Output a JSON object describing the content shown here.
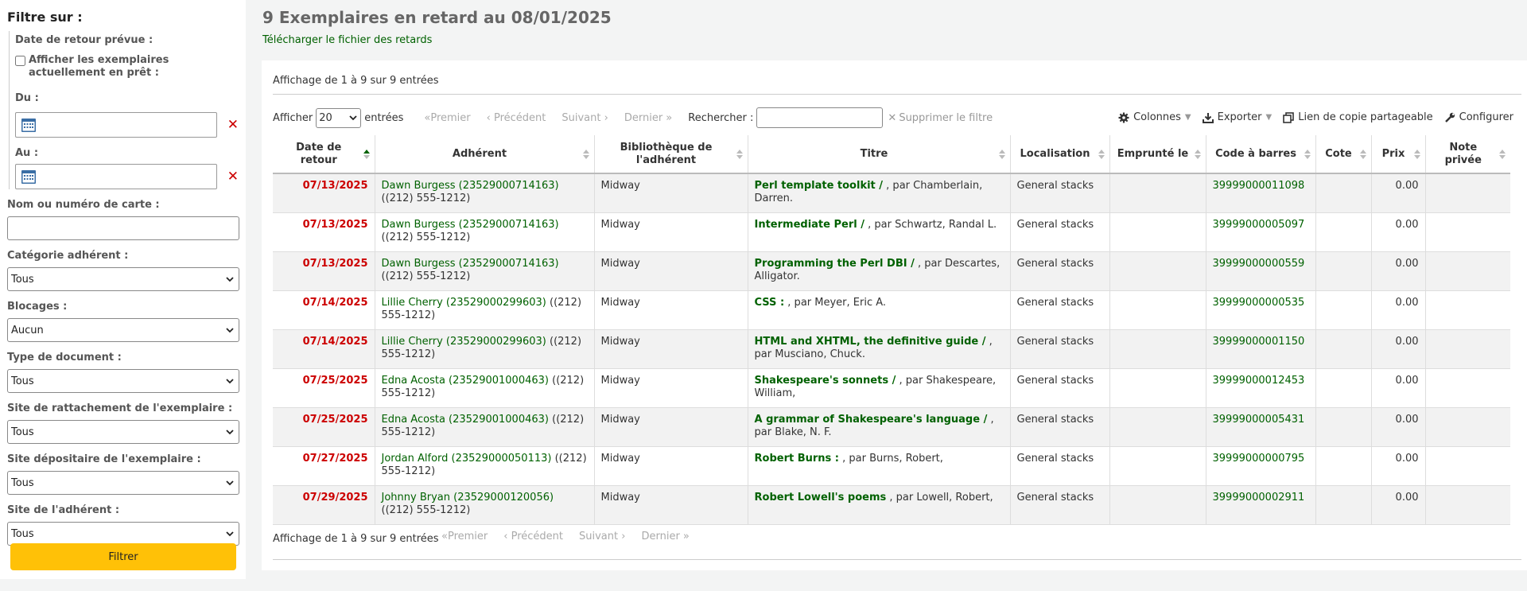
{
  "sidebar": {
    "heading": "Filtre sur :",
    "due_date_label": "Date de retour prévue :",
    "show_checked_out_label": "Afficher les exemplaires actuellement en prêt :",
    "from_label": "Du :",
    "to_label": "Au :",
    "patron_label": "Nom ou numéro de carte :",
    "patron_value": "",
    "category_label": "Catégorie adhérent :",
    "category_value": "Tous",
    "restrictions_label": "Blocages :",
    "restrictions_value": "Aucun",
    "itemtype_label": "Type de document :",
    "itemtype_value": "Tous",
    "homebranch_label": "Site de rattachement de l'exemplaire :",
    "homebranch_value": "Tous",
    "holdingbranch_label": "Site dépositaire de l'exemplaire :",
    "holdingbranch_value": "Tous",
    "patronbranch_label": "Site de l'adhérent :",
    "patronbranch_value": "Tous",
    "filter_button": "Filtrer"
  },
  "main": {
    "title": "9 Exemplaires en retard au 08/01/2025",
    "download_link": "Télécharger le fichier des retards",
    "info_top": "Affichage de 1 à 9 sur 9 entrées",
    "info_bottom": "Affichage de 1 à 9 sur 9 entrées",
    "show_label": "Afficher",
    "page_size": "20",
    "entries_label": "entrées",
    "pager": {
      "first": "Premier",
      "prev": "Précédent",
      "next": "Suivant",
      "last": "Dernier"
    },
    "search_label": "Rechercher :",
    "search_value": "",
    "clear_filter": "Supprimer le filtre",
    "columns_btn": "Colonnes",
    "export_btn": "Exporter",
    "share_btn": "Lien de copie partageable",
    "configure_btn": "Configurer"
  },
  "table": {
    "headers": [
      "Date de retour",
      "Adhérent",
      "Bibliothèque de l'adhérent",
      "Titre",
      "Localisation",
      "Emprunté le",
      "Code à barres",
      "Cote",
      "Prix",
      "Note privée"
    ],
    "rows": [
      {
        "due": "07/13/2025",
        "patron": "Dawn Burgess (23529000714163)",
        "phone": "((212) 555-1212)",
        "library": "Midway",
        "title": "Perl template toolkit /",
        "author": ", par Chamberlain, Darren.",
        "location": "General stacks",
        "checkout": "",
        "barcode": "39999000011098",
        "callnumber": "",
        "price": "0.00",
        "note": ""
      },
      {
        "due": "07/13/2025",
        "patron": "Dawn Burgess (23529000714163)",
        "phone": "((212) 555-1212)",
        "library": "Midway",
        "title": "Intermediate Perl /",
        "author": ", par Schwartz, Randal L.",
        "location": "General stacks",
        "checkout": "",
        "barcode": "39999000005097",
        "callnumber": "",
        "price": "0.00",
        "note": ""
      },
      {
        "due": "07/13/2025",
        "patron": "Dawn Burgess (23529000714163)",
        "phone": "((212) 555-1212)",
        "library": "Midway",
        "title": "Programming the Perl DBI /",
        "author": ", par Descartes, Alligator.",
        "location": "General stacks",
        "checkout": "",
        "barcode": "39999000000559",
        "callnumber": "",
        "price": "0.00",
        "note": ""
      },
      {
        "due": "07/14/2025",
        "patron": "Lillie Cherry (23529000299603)",
        "phone": "((212) 555-1212)",
        "library": "Midway",
        "title": "CSS :",
        "author": ", par Meyer, Eric A.",
        "location": "General stacks",
        "checkout": "",
        "barcode": "39999000000535",
        "callnumber": "",
        "price": "0.00",
        "note": ""
      },
      {
        "due": "07/14/2025",
        "patron": "Lillie Cherry (23529000299603)",
        "phone": "((212) 555-1212)",
        "library": "Midway",
        "title": "HTML and XHTML, the definitive guide /",
        "author": ", par Musciano, Chuck.",
        "location": "General stacks",
        "checkout": "",
        "barcode": "39999000001150",
        "callnumber": "",
        "price": "0.00",
        "note": ""
      },
      {
        "due": "07/25/2025",
        "patron": "Edna Acosta (23529001000463)",
        "phone": "((212) 555-1212)",
        "library": "Midway",
        "title": "Shakespeare's sonnets /",
        "author": ", par Shakespeare, William,",
        "location": "General stacks",
        "checkout": "",
        "barcode": "39999000012453",
        "callnumber": "",
        "price": "0.00",
        "note": ""
      },
      {
        "due": "07/25/2025",
        "patron": "Edna Acosta (23529001000463)",
        "phone": "((212) 555-1212)",
        "library": "Midway",
        "title": "A grammar of Shakespeare's language /",
        "author": ", par Blake, N. F.",
        "location": "General stacks",
        "checkout": "",
        "barcode": "39999000005431",
        "callnumber": "",
        "price": "0.00",
        "note": ""
      },
      {
        "due": "07/27/2025",
        "patron": "Jordan Alford (23529000050113)",
        "phone": "((212) 555-1212)",
        "library": "Midway",
        "title": "Robert Burns :",
        "author": ", par Burns, Robert,",
        "location": "General stacks",
        "checkout": "",
        "barcode": "39999000000795",
        "callnumber": "",
        "price": "0.00",
        "note": ""
      },
      {
        "due": "07/29/2025",
        "patron": "Johnny Bryan (23529000120056)",
        "phone": "((212) 555-1212)",
        "library": "Midway",
        "title": "Robert Lowell's poems",
        "author": ", par Lowell, Robert,",
        "location": "General stacks",
        "checkout": "",
        "barcode": "39999000002911",
        "callnumber": "",
        "price": "0.00",
        "note": ""
      }
    ]
  },
  "colors": {
    "link": "#006100",
    "due": "#cc0000",
    "button": "#ffc107"
  }
}
